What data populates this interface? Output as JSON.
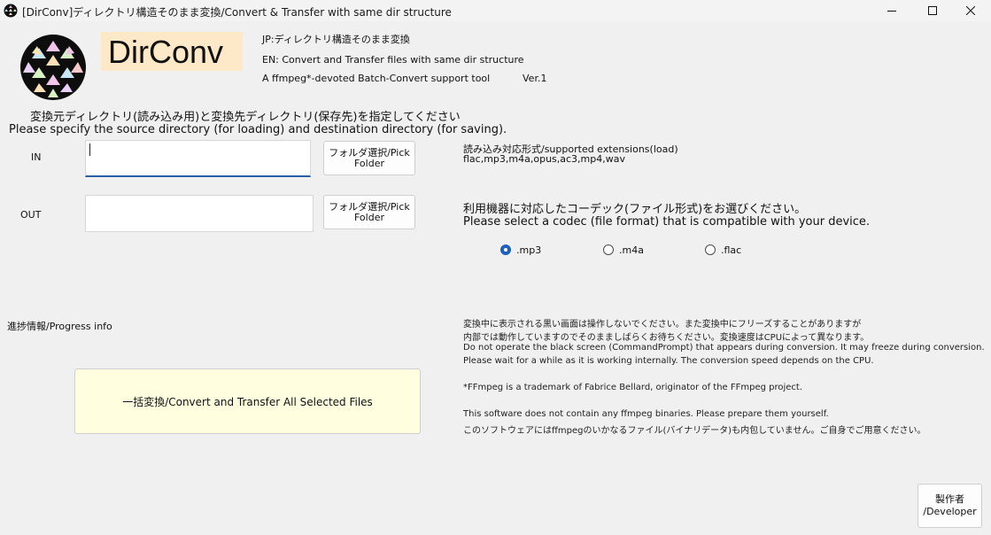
{
  "window": {
    "title": "[DirConv]ディレクトリ構造そのまま変換/Convert & Transfer with same dir structure",
    "minimize_icon": "minimize-icon",
    "maximize_icon": "maximize-icon",
    "close_icon": "close-icon"
  },
  "header": {
    "brand": "DirConv",
    "brand_bg_color": "#fde8c8",
    "desc_jp": "JP:ディレクトリ構造そのまま変換",
    "desc_en": "EN: Convert and Transfer files with same dir structure",
    "tagline": "A ffmpeg*-devoted Batch-Convert support tool",
    "version": "Ver.1"
  },
  "instructions": {
    "jp": "変換元ディレクトリ(読み込み用)と変換先ディレクトリ(保存先)を指定してください",
    "en": "Please specify the source directory (for loading) and destination directory (for saving)."
  },
  "io": {
    "in_label": "IN",
    "in_value": "",
    "out_label": "OUT",
    "out_value": "",
    "pick_in_line1": "フォルダ選択/Pick",
    "pick_in_line2": "Folder",
    "pick_out_line1": "フォルダ選択/Pick",
    "pick_out_line2": "Folder"
  },
  "extensions": {
    "label": "読み込み対応形式/supported extensions(load)",
    "list": "flac,mp3,m4a,opus,ac3,mp4,wav"
  },
  "codec": {
    "prompt_jp": "利用機器に対応したコーデック(ファイル形式)をお選びください。",
    "prompt_en": "Please select a codec (file format) that is compatible with your device.",
    "options": [
      {
        "label": ".mp3",
        "selected": true
      },
      {
        "label": ".m4a",
        "selected": false
      },
      {
        "label": ".flac",
        "selected": false
      }
    ]
  },
  "progress": {
    "label": "進捗情報/Progress info"
  },
  "convert_button": {
    "label": "一括変換/Convert and Transfer All Selected Files",
    "bg_color": "#ffffe0"
  },
  "notes": {
    "line1": "変換中に表示される黒い画面は操作しないでください。また変換中にフリーズすることがありますが",
    "line2": "内部では動作していますのでそのまましばらくお待ちください。変換速度はCPUによって異なります。",
    "line3": "Do not operate the black screen (CommandPrompt) that appears during conversion. It may freeze during conversion.",
    "line4": "Please wait for a while as it is working internally. The conversion speed depends on the CPU.",
    "line5": "*FFmpeg is a trademark of Fabrice Bellard, originator of the FFmpeg project.",
    "line6": "This software does not contain any ffmpeg binaries. Please prepare them yourself.",
    "line7": "このソフトウェアにはffmpegのいかなるファイル(バイナリデータ)も内包していません。ご自身でご用意ください。"
  },
  "developer_button": {
    "line1": "製作者",
    "line2": "/Developer"
  }
}
